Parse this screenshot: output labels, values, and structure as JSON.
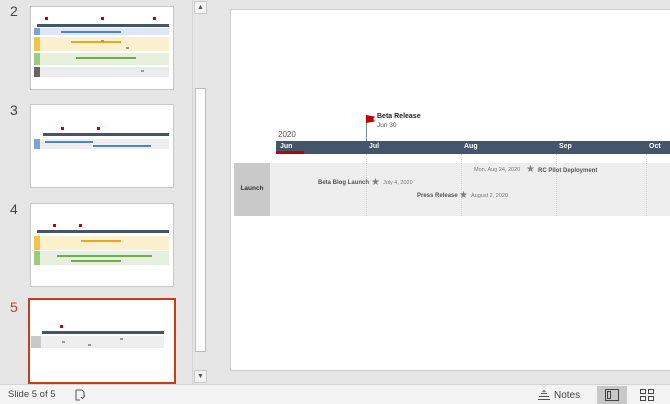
{
  "thumbnails": [
    {
      "number": "2",
      "active": false
    },
    {
      "number": "3",
      "active": false
    },
    {
      "number": "4",
      "active": false
    },
    {
      "number": "5",
      "active": true
    }
  ],
  "slide": {
    "year": "2020",
    "months": [
      "Jun",
      "Jul",
      "Aug",
      "Sep",
      "Oct"
    ],
    "swimlane": "Launch",
    "flag_milestone": {
      "title": "Beta Release",
      "date": "Jun 30"
    },
    "milestones": [
      {
        "name": "Beta Blog Launch",
        "date": "July 4, 2020"
      },
      {
        "name": "RC Pilot Deployment",
        "date": "Mon, Aug 24, 2020"
      },
      {
        "name": "Press Release",
        "date": "August 2, 2020"
      }
    ]
  },
  "status": {
    "slide_indicator": "Slide 5 of 5",
    "notes_label": "Notes"
  },
  "colors": {
    "accent": "#c43e1c",
    "timescale": "#44546a",
    "flag": "#c00000"
  }
}
